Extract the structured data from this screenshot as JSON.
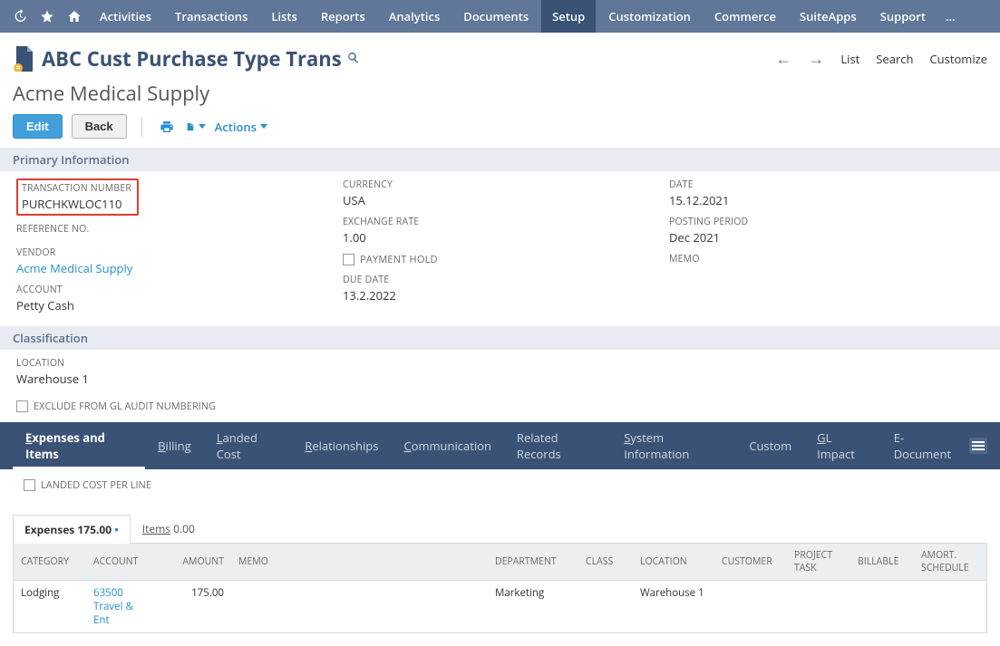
{
  "nav": {
    "items": [
      "Activities",
      "Transactions",
      "Lists",
      "Reports",
      "Analytics",
      "Documents",
      "Setup",
      "Customization",
      "Commerce",
      "SuiteApps",
      "Support"
    ],
    "active_index": 6,
    "more": "..."
  },
  "page": {
    "title": "ABC Cust Purchase Type Trans",
    "subtitle": "Acme Medical Supply",
    "header_links": {
      "list": "List",
      "search": "Search",
      "customize": "Customize"
    },
    "buttons": {
      "edit": "Edit",
      "back": "Back",
      "actions": "Actions"
    }
  },
  "sections": {
    "primary": "Primary Information",
    "classification": "Classification"
  },
  "fields": {
    "transaction_number": {
      "label": "TRANSACTION NUMBER",
      "value": "PURCHKWLOC110"
    },
    "reference_no": {
      "label": "REFERENCE NO."
    },
    "vendor": {
      "label": "VENDOR",
      "value": "Acme Medical Supply"
    },
    "account": {
      "label": "ACCOUNT",
      "value": "Petty Cash"
    },
    "currency": {
      "label": "CURRENCY",
      "value": "USA"
    },
    "exchange_rate": {
      "label": "EXCHANGE RATE",
      "value": "1.00"
    },
    "payment_hold": {
      "label": "PAYMENT HOLD"
    },
    "due_date": {
      "label": "DUE DATE",
      "value": "13.2.2022"
    },
    "date": {
      "label": "DATE",
      "value": "15.12.2021"
    },
    "posting_period": {
      "label": "POSTING PERIOD",
      "value": "Dec 2021"
    },
    "memo": {
      "label": "MEMO"
    },
    "location": {
      "label": "LOCATION",
      "value": "Warehouse 1"
    },
    "exclude_gl": {
      "label": "EXCLUDE FROM GL AUDIT NUMBERING"
    },
    "landed_cost_per_line": {
      "label": "LANDED COST PER LINE"
    }
  },
  "tabs": {
    "items": [
      {
        "u": "E",
        "rest": "xpenses and Items"
      },
      {
        "u": "B",
        "rest": "illing"
      },
      {
        "u": "L",
        "rest": "anded Cost"
      },
      {
        "u": "R",
        "rest": "elationships"
      },
      {
        "u": "C",
        "rest": "ommunication"
      },
      {
        "u": "",
        "rest": "Related Records"
      },
      {
        "u": "S",
        "rest": "ystem Information"
      },
      {
        "u": "",
        "rest": "Custom"
      },
      {
        "u": "G",
        "rest": "L Impact"
      },
      {
        "u": "",
        "rest": "E-Document"
      }
    ],
    "active_index": 0
  },
  "subtabs": {
    "expenses": {
      "label": "Expenses",
      "amount": "175.00"
    },
    "items": {
      "label": "Items",
      "amount": "0.00"
    }
  },
  "table": {
    "headers": [
      "CATEGORY",
      "ACCOUNT",
      "AMOUNT",
      "MEMO",
      "DEPARTMENT",
      "CLASS",
      "LOCATION",
      "CUSTOMER",
      "PROJECT TASK",
      "BILLABLE",
      "AMORT. SCHEDULE"
    ],
    "rows": [
      {
        "category": "Lodging",
        "account": "63500 Travel & Ent",
        "amount": "175.00",
        "memo": "",
        "department": "Marketing",
        "class": "",
        "location": "Warehouse 1",
        "customer": "",
        "project_task": "",
        "billable": "",
        "amort": ""
      }
    ]
  }
}
